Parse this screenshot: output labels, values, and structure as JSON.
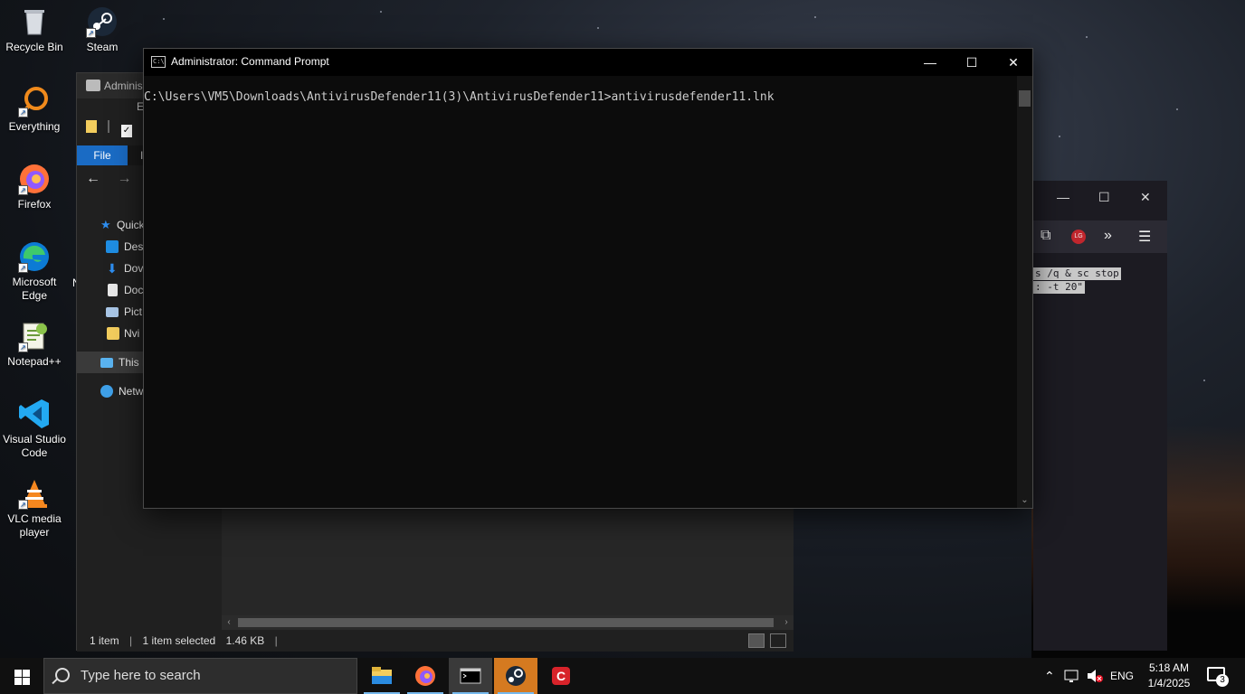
{
  "desktop": {
    "icons": [
      {
        "label": "Recycle Bin",
        "icon": "recycle-bin-icon"
      },
      {
        "label": "Steam",
        "icon": "steam-icon"
      },
      {
        "label": "Everything",
        "icon": "everything-icon"
      },
      {
        "label": "Firefox",
        "icon": "firefox-icon"
      },
      {
        "label": "Microsoft Edge",
        "icon": "edge-icon"
      },
      {
        "label": "Notepad++",
        "icon": "notepadpp-icon"
      },
      {
        "label": "Visual Studio Code",
        "icon": "vscode-icon"
      },
      {
        "label": "VLC media player",
        "icon": "vlc-icon"
      }
    ],
    "partial_label_n": "N"
  },
  "explorer": {
    "title_partial": "Adminis",
    "ribbon_file": "File",
    "ribbon_partial": "I",
    "header_partial": "E",
    "nav": [
      {
        "label": "Quick",
        "icon": "star-icon"
      },
      {
        "label": "Des",
        "icon": "desktop-folder-icon"
      },
      {
        "label": "Dov",
        "icon": "downloads-icon"
      },
      {
        "label": "Doc",
        "icon": "documents-icon"
      },
      {
        "label": "Pict",
        "icon": "pictures-icon"
      },
      {
        "label": "Nvi",
        "icon": "folder-icon"
      },
      {
        "label": "This F",
        "icon": "this-pc-icon"
      },
      {
        "label": "Netw",
        "icon": "network-icon"
      }
    ],
    "status": {
      "items": "1 item",
      "selected": "1 item selected",
      "size": "1.46 KB",
      "sep": "|"
    }
  },
  "firefox": {
    "selected_lines": [
      "s /q & sc stop",
      ": -t 20\""
    ],
    "extension_badge": "LG"
  },
  "cmd": {
    "title": "Administrator: Command Prompt",
    "icon_text": "C:\\",
    "line1": "C:\\Users\\VM5\\Downloads\\AntivirusDefender11(3)\\AntivirusDefender11>antivirusdefender11.lnk"
  },
  "taskbar": {
    "search_placeholder": "Type here to search",
    "apps": [
      {
        "name": "file-explorer",
        "icon": "file-explorer-icon",
        "active": false
      },
      {
        "name": "firefox",
        "icon": "firefox-icon",
        "active": false
      },
      {
        "name": "command-prompt",
        "icon": "terminal-icon",
        "active": true
      },
      {
        "name": "steam",
        "icon": "steam-icon",
        "active": true
      },
      {
        "name": "ccleaner",
        "icon": "ccleaner-icon",
        "active": false
      }
    ],
    "language": "ENG",
    "time": "5:18 AM",
    "date": "1/4/2025",
    "notification_count": "3",
    "colors": {
      "accent": "#76b9ed",
      "explorer_blue": "#1a6bc4",
      "vscode_blue": "#23a9f2"
    }
  }
}
